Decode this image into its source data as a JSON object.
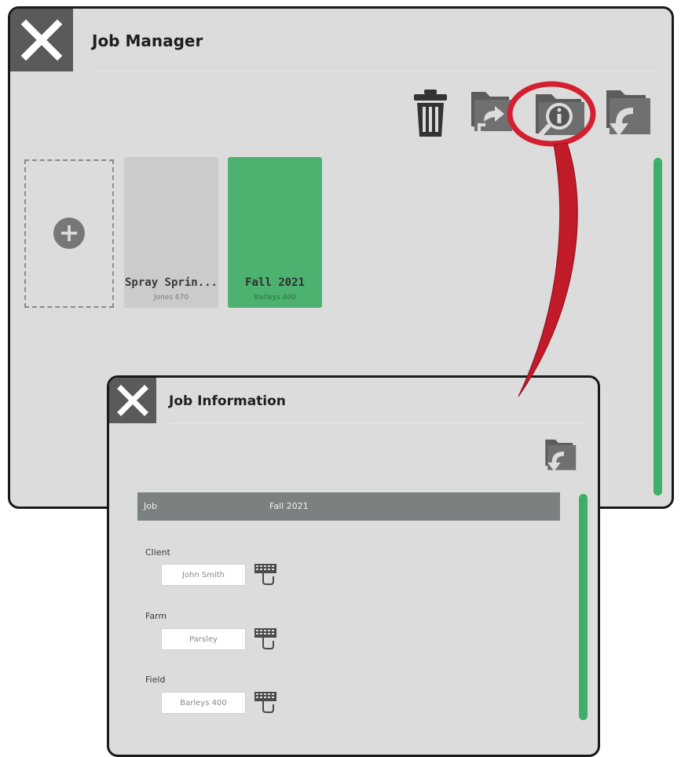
{
  "job_manager": {
    "title": "Job Manager",
    "toolbar": [
      "trash-icon",
      "folder-export-icon",
      "folder-info-icon",
      "folder-import-icon"
    ],
    "highlighted_tool": "folder-info-icon",
    "jobs": [
      {
        "name": "Spray Sprin...",
        "subtitle": "Jones 670",
        "selected": false
      },
      {
        "name": "Fall 2021",
        "subtitle": "Barleys 400",
        "selected": true
      }
    ]
  },
  "job_info": {
    "title": "Job Information",
    "toolbar": [
      "folder-import-icon"
    ],
    "job_row": {
      "label": "Job",
      "value": "Fall 2021"
    },
    "fields": [
      {
        "label": "Client",
        "value": "John Smith"
      },
      {
        "label": "Farm",
        "value": "Parsley"
      },
      {
        "label": "Field",
        "value": "Barleys 400"
      }
    ]
  },
  "colors": {
    "panel_bg": "#dcdcdc",
    "selected_tile": "#4db270",
    "scrollbar": "#3fae69",
    "highlight": "#d32030",
    "close_bg": "#5a5a5a"
  }
}
